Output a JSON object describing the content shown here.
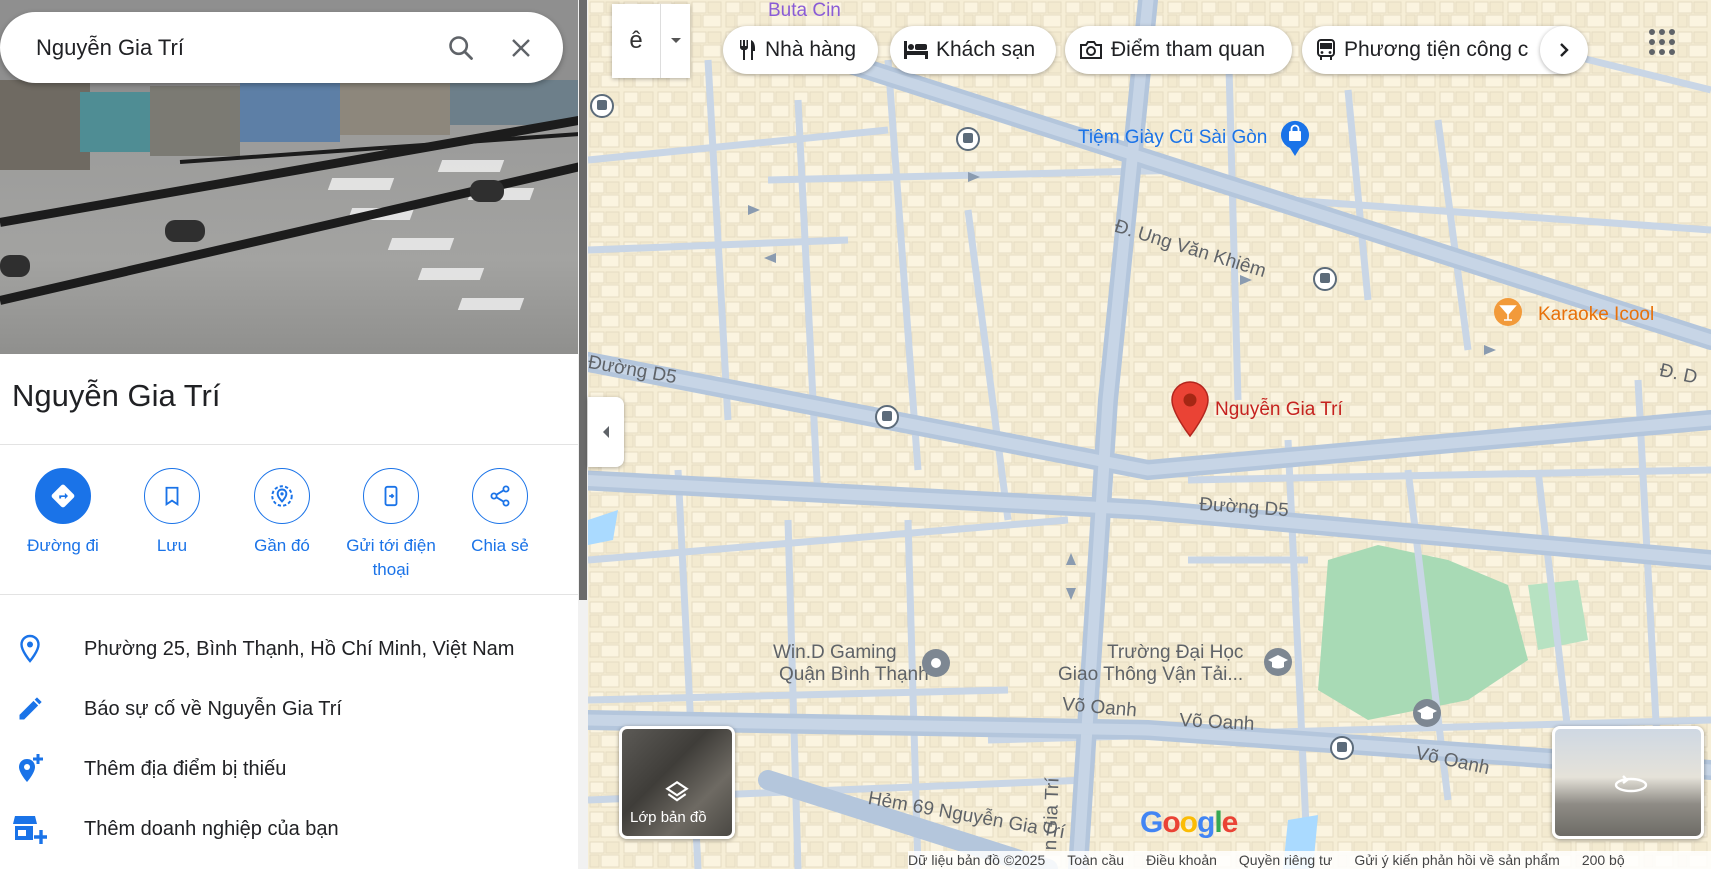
{
  "search": {
    "query": "Nguyễn Gia Trí"
  },
  "place": {
    "title": "Nguyễn Gia Trí",
    "actions": [
      {
        "label": "Đường đi"
      },
      {
        "label": "Lưu"
      },
      {
        "label": "Gần đó"
      },
      {
        "label": "Gửi tới điện thoại"
      },
      {
        "label": "Chia sẻ"
      }
    ],
    "info": [
      {
        "text": "Phường 25, Bình Thạnh, Hồ Chí Minh, Việt Nam",
        "icon": "location-pin-icon"
      },
      {
        "text": "Báo sự cố về Nguyễn Gia Trí",
        "icon": "pencil-icon"
      },
      {
        "text": "Thêm địa điểm bị thiếu",
        "icon": "add-location-icon"
      },
      {
        "text": "Thêm doanh nghiệp của bạn",
        "icon": "add-business-icon"
      }
    ]
  },
  "map": {
    "lang_button": "ê",
    "chips": [
      {
        "label": "Nhà hàng",
        "icon": "restaurant-icon"
      },
      {
        "label": "Khách sạn",
        "icon": "hotel-icon"
      },
      {
        "label": "Điểm tham quan",
        "icon": "camera-icon"
      },
      {
        "label": "Phương tiện công c",
        "icon": "transit-icon"
      }
    ],
    "labels": {
      "tiem_giay": "Tiệm Giày Cũ Sài Gòn",
      "ung_van_khiem": "Đ. Ung Văn Khiêm",
      "karaoke": "Karaoke Icool",
      "duong_d5_left": "Đường D5",
      "duong_d5_mid": "Đường D5",
      "d_right": "Đ. D",
      "marker": "Nguyễn Gia Trí",
      "win_d_1": "Win.D Gaming",
      "win_d_2": "Quận Bình Thạnh",
      "truong_1": "Trường Đại Học",
      "truong_2": "Giao Thông Vận Tải...",
      "vo_oanh_1": "Võ Oanh",
      "vo_oanh_2": "Võ Oanh",
      "vo_oanh_3": "Võ Oanh",
      "hem_69": "Hẻm 69 Nguyễn Gia Trí",
      "gia_tri_vertical": "n Gia Trí",
      "top_partial": "Buta Cin"
    },
    "layers_label": "Lớp bản đồ",
    "google_logo": "Google",
    "footer": {
      "copyright": "Dữ liệu bản đồ ©2025",
      "global": "Toàn cầu",
      "terms": "Điều khoản",
      "privacy": "Quyền riêng tư",
      "feedback": "Gửi ý kiến phản hồi về sản phẩm",
      "scale": "200 bộ"
    },
    "colors": {
      "accent": "#1a73e8",
      "marker": "#ea4335",
      "park": "#a8dab5"
    }
  }
}
